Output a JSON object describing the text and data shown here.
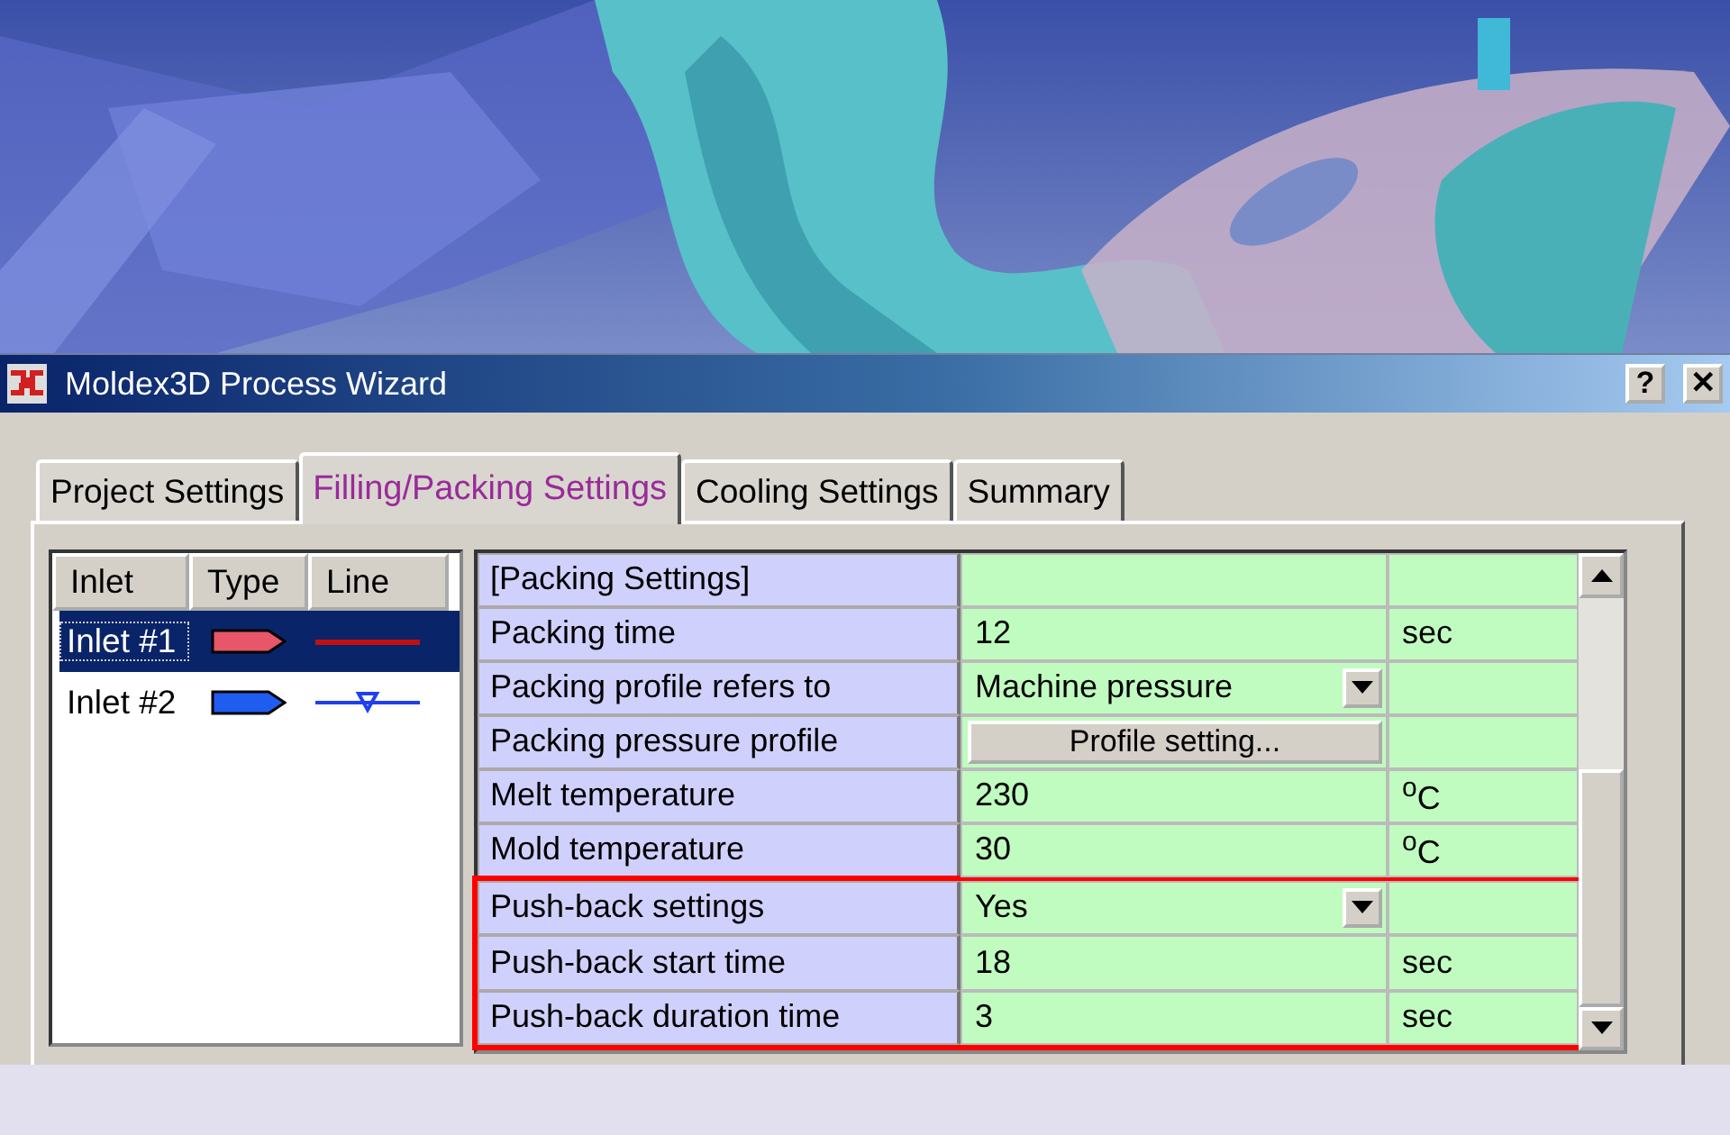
{
  "window": {
    "title": "Moldex3D Process Wizard",
    "buttons": [
      "?",
      "✕"
    ]
  },
  "tabs": [
    {
      "label": "Project Settings",
      "selected": false
    },
    {
      "label": "Filling/Packing Settings",
      "selected": true
    },
    {
      "label": "Cooling Settings",
      "selected": false
    },
    {
      "label": "Summary",
      "selected": false
    }
  ],
  "inlet_table": {
    "columns": [
      "Inlet",
      "Type",
      "Line"
    ],
    "rows": [
      {
        "name": "Inlet #1",
        "selected": true,
        "color": "#e8566a",
        "kind": "solid"
      },
      {
        "name": "Inlet #2",
        "selected": false,
        "color": "#1f5cf0",
        "kind": "marker"
      }
    ]
  },
  "settings": [
    {
      "kind": "header",
      "label": "[Packing Settings]",
      "highlighted": false
    },
    {
      "kind": "text",
      "label": "Packing time",
      "value": "12",
      "unit": "sec",
      "highlighted": false
    },
    {
      "kind": "dropdown",
      "label": "Packing profile refers to",
      "value": "Machine pressure",
      "highlighted": false
    },
    {
      "kind": "button",
      "label": "Packing pressure profile",
      "value": "Profile setting...",
      "highlighted": false
    },
    {
      "kind": "text",
      "label": "Melt temperature",
      "value": "230",
      "unit": "$^{o}$C",
      "highlighted": false
    },
    {
      "kind": "text",
      "label": "Mold temperature",
      "value": "30",
      "unit": "$^{o}$C",
      "highlighted": false
    },
    {
      "kind": "dropdown",
      "label": "Push-back settings",
      "value": "Yes",
      "highlighted": true
    },
    {
      "kind": "text",
      "label": "Push-back start time",
      "value": "18",
      "unit": "sec",
      "highlighted": true
    },
    {
      "kind": "text",
      "label": "Push-back duration time",
      "value": "3",
      "unit": "sec",
      "highlighted": true
    }
  ]
}
